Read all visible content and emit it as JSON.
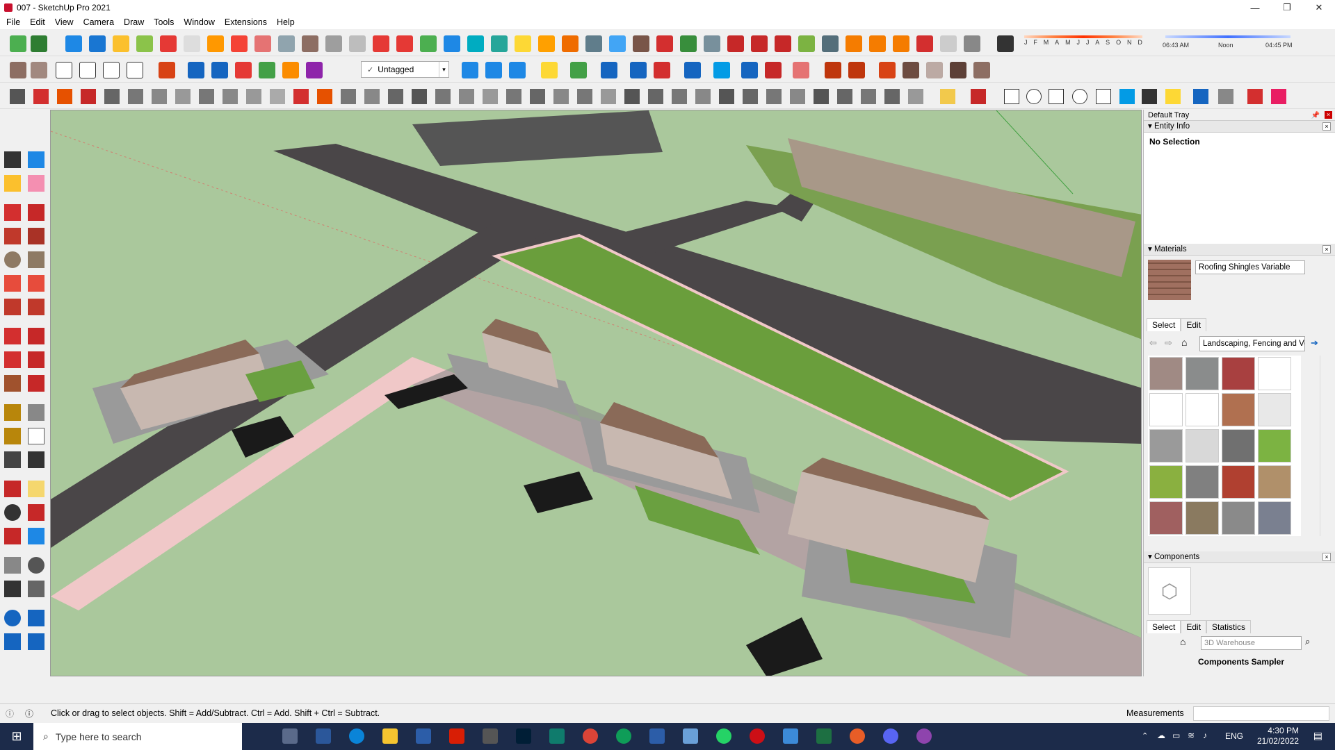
{
  "window": {
    "title": "007 - SketchUp Pro 2021",
    "minimize": "—",
    "maximize": "❐",
    "close": "✕"
  },
  "menu": [
    "File",
    "Edit",
    "View",
    "Camera",
    "Draw",
    "Tools",
    "Window",
    "Extensions",
    "Help"
  ],
  "toolbar": {
    "tag_checkmark": "✓",
    "tag_value": "Untagged",
    "dropdown_arrow": "▾"
  },
  "shadows": {
    "months": [
      "J",
      "F",
      "M",
      "A",
      "M",
      "J",
      "J",
      "A",
      "S",
      "O",
      "N",
      "D"
    ],
    "time_start": "06:43 AM",
    "time_mid": "Noon",
    "time_end": "04:45 PM"
  },
  "tray": {
    "title": "Default Tray",
    "pin": "📌",
    "close": "×",
    "entity_info": {
      "header": "Entity Info",
      "value": "No Selection"
    },
    "materials": {
      "header": "Materials",
      "current_name": "Roofing Shingles Variable",
      "tab_select": "Select",
      "tab_edit": "Edit",
      "library": "Landscaping, Fencing and Vegetation",
      "swatch_colors": [
        "#a08a84",
        "#8a8c8c",
        "#a84040",
        "#ffffff",
        "#ffffff",
        "#ffffff",
        "#b07050",
        "#e8e8e8",
        "#9a9a9a",
        "#d8d8d8",
        "#707070",
        "#7cb342",
        "#8ab040",
        "#808080",
        "#b04030",
        "#b0906a",
        "#a06060",
        "#8a7a60",
        "#8a8a8a",
        "#7a8090"
      ]
    },
    "components": {
      "header": "Components",
      "tab_select": "Select",
      "tab_edit": "Edit",
      "tab_statistics": "Statistics",
      "search_placeholder": "3D Warehouse",
      "sampler_label": "Components Sampler"
    }
  },
  "status": {
    "message": "Click or drag to select objects. Shift = Add/Subtract. Ctrl = Add. Shift + Ctrl = Subtract.",
    "measurements_label": "Measurements"
  },
  "taskbar": {
    "search_placeholder": "Type here to search",
    "start_icon": "⊞",
    "search_icon": "⌕",
    "language": "ENG",
    "time": "4:30 PM",
    "date": "21/02/2022"
  }
}
